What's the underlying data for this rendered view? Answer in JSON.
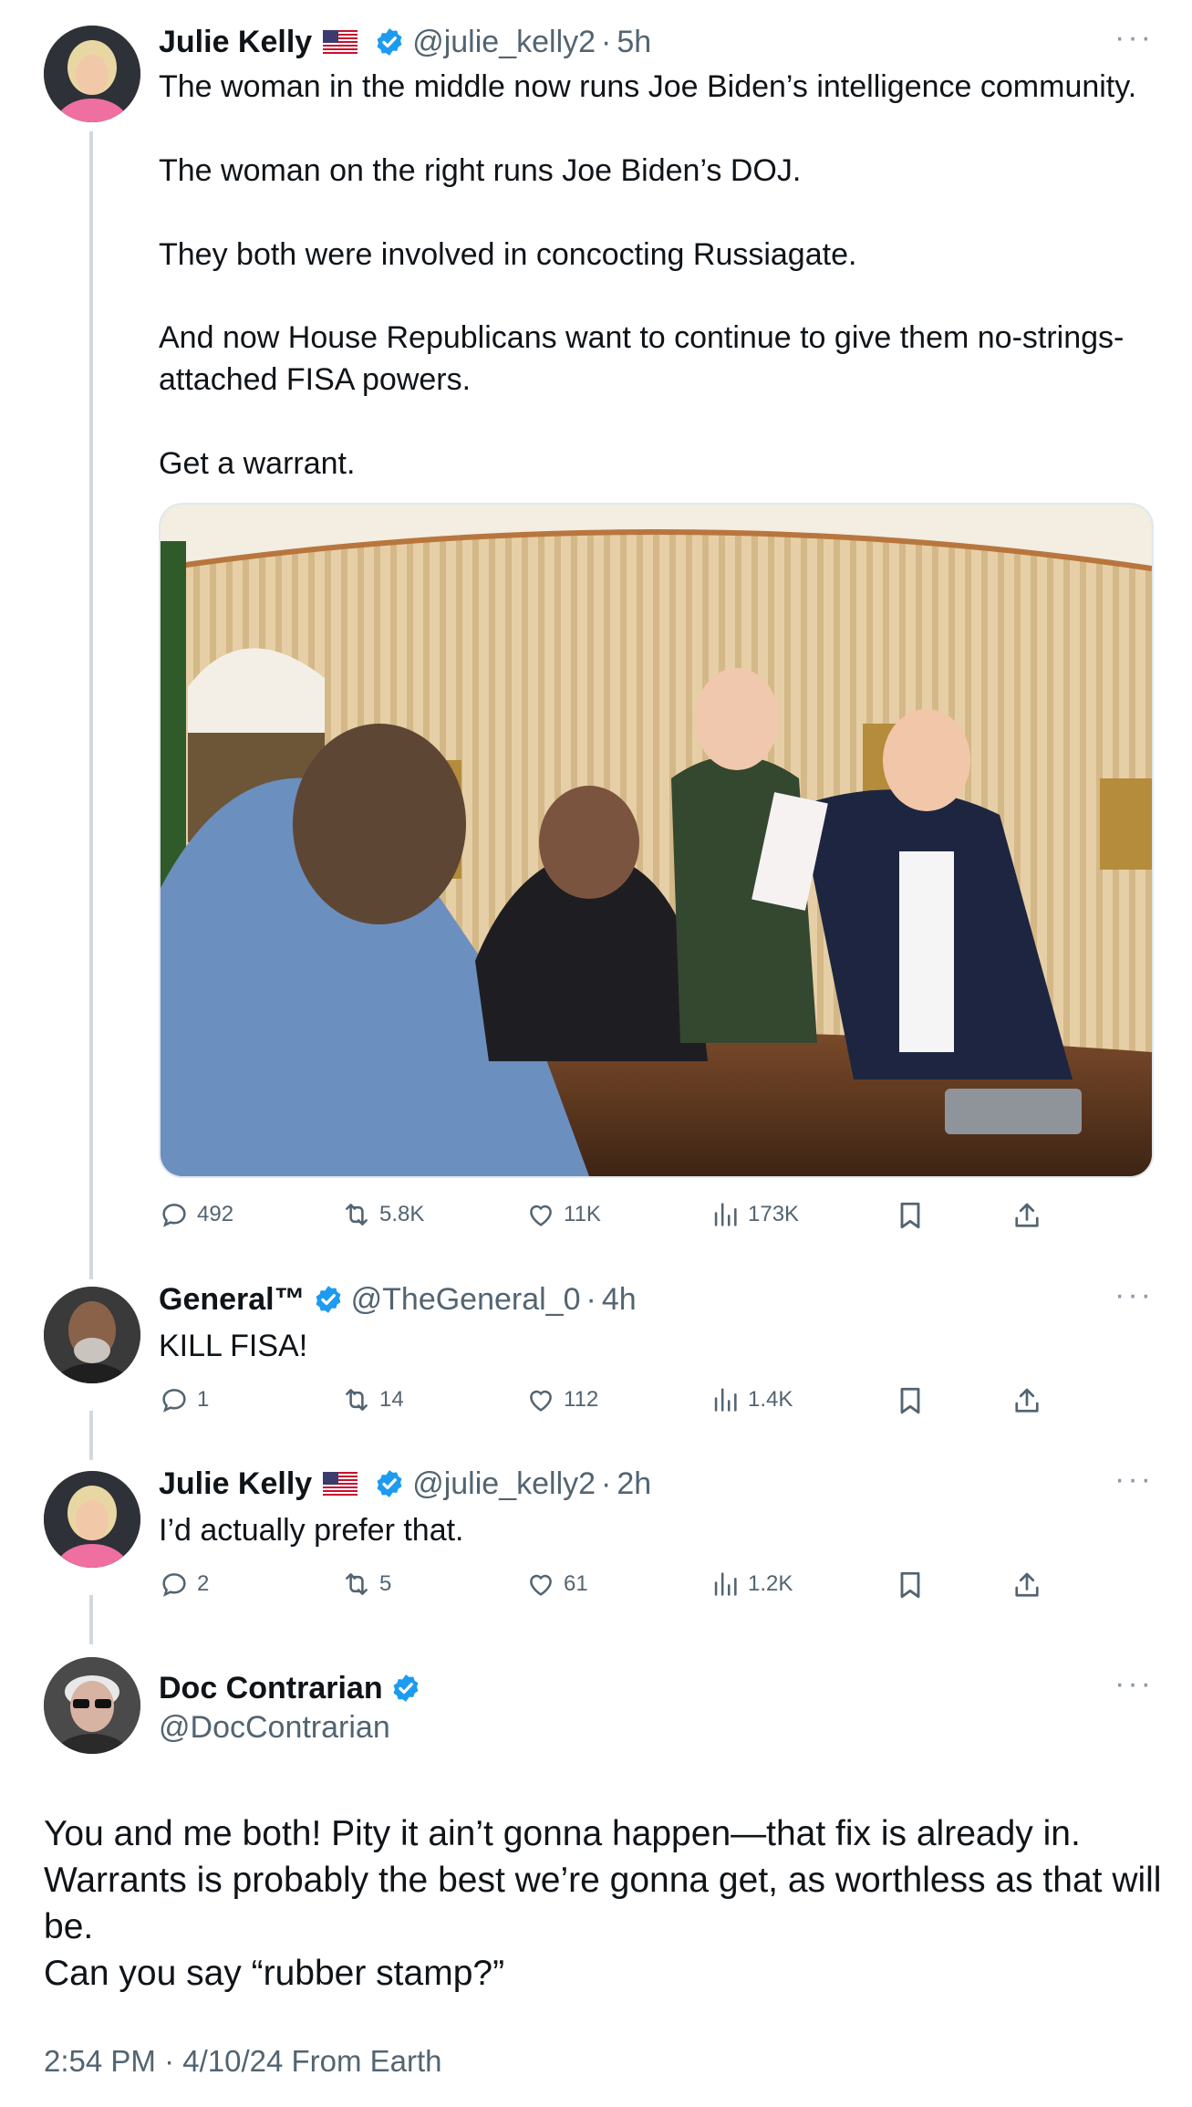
{
  "tweets": [
    {
      "name": "Julie Kelly",
      "handle": "@julie_kelly2",
      "time": "5h",
      "lines": [
        "The woman in the middle now runs Joe Biden’s intelligence community.",
        "The woman on the right runs Joe Biden’s DOJ.",
        "They both were involved in concocting Russiagate.",
        "And now House Republicans want to continue to give them no-strings-",
        "attached FISA powers.",
        "Get a warrant."
      ],
      "stats": {
        "replies": "492",
        "reposts": "5.8K",
        "likes": "11K",
        "views": "173K"
      }
    },
    {
      "name": "General™",
      "handle": "@TheGeneral_0",
      "time": "4h",
      "text": "KILL FISA!",
      "stats": {
        "replies": "1",
        "reposts": "14",
        "likes": "112",
        "views": "1.4K"
      }
    },
    {
      "name": "Julie Kelly",
      "handle": "@julie_kelly2",
      "time": "2h",
      "text": "I’d actually prefer that.",
      "stats": {
        "replies": "2",
        "reposts": "5",
        "likes": "61",
        "views": "1.2K"
      }
    }
  ],
  "main_tweet": {
    "name": "Doc Contrarian",
    "handle": "@DocContrarian",
    "lines": [
      "You and me both! Pity it ain’t gonna happen—that fix is already in.",
      "Warrants is probably the best we’re gonna get, as worthless as that will",
      "be.",
      "Can you say “rubber stamp?”"
    ],
    "timestamp": "2:54 PM · 4/10/24 From Earth"
  },
  "separator": "·",
  "more_label": "···",
  "icons": {
    "reply": "reply-icon",
    "repost": "repost-icon",
    "like": "heart-icon",
    "views": "views-icon",
    "bookmark": "bookmark-icon",
    "share": "share-icon",
    "verified": "verified-badge-icon",
    "flag": "us-flag-icon"
  },
  "colors": {
    "verified": "#1d9bf0",
    "secondary_text": "#536471",
    "thread_line": "#cfd9de"
  }
}
